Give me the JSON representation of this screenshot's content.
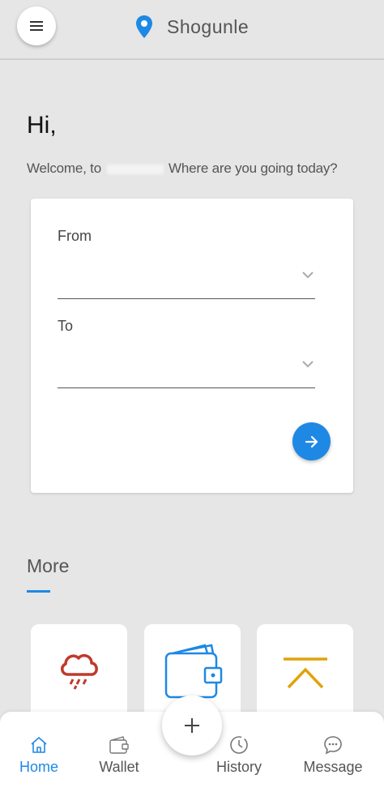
{
  "header": {
    "title": "Shogunle",
    "menu_icon": "hamburger-menu-icon",
    "location_icon": "location-pin-icon",
    "accent": "#1e88e5"
  },
  "greeting": {
    "hi": "Hi,",
    "welcome_prefix": "Welcome, to",
    "welcome_suffix": "Where are you going today?"
  },
  "route": {
    "from_label": "From",
    "to_label": "To",
    "submit_icon": "arrow-right-icon"
  },
  "more": {
    "title": "More",
    "tiles": [
      {
        "icon": "weather-rain-icon",
        "color": "#c0392b"
      },
      {
        "icon": "wallet-icon",
        "color": "#1e88e5"
      },
      {
        "icon": "chevron-up-icon",
        "color": "#e0a30c"
      }
    ]
  },
  "bottom_nav": {
    "items": [
      {
        "label": "Home",
        "icon": "home-icon",
        "active": true
      },
      {
        "label": "Wallet",
        "icon": "wallet-icon",
        "active": false
      },
      {
        "label": "History",
        "icon": "clock-icon",
        "active": false
      },
      {
        "label": "Message",
        "icon": "chat-icon",
        "active": false
      }
    ],
    "fab_icon": "plus-icon"
  }
}
